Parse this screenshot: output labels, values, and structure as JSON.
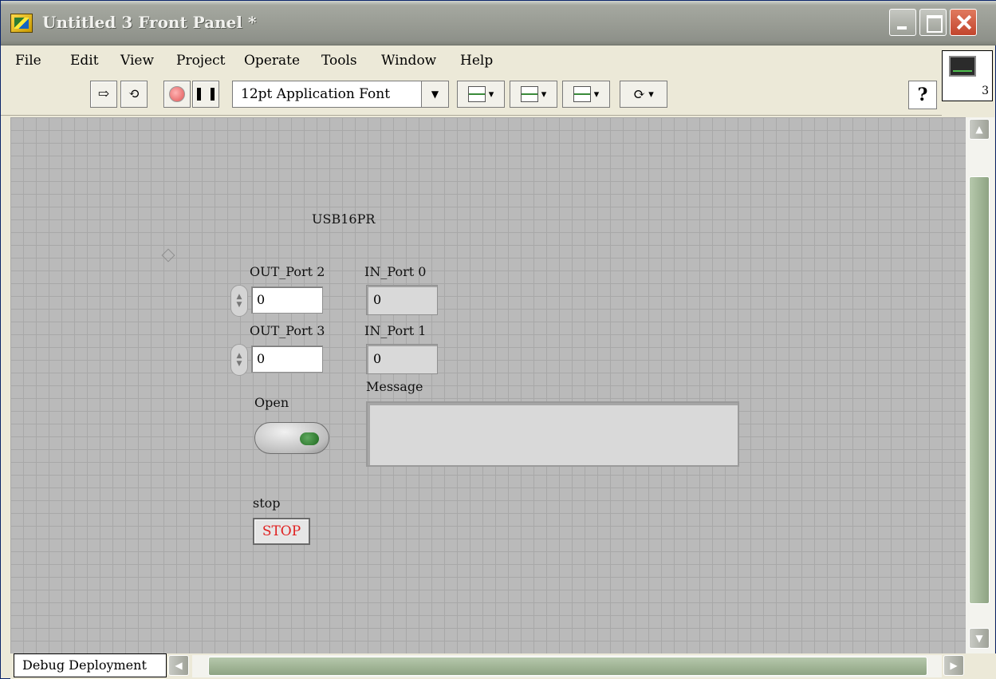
{
  "window": {
    "title": "Untitled 3 Front Panel *"
  },
  "menu": {
    "items": [
      "File",
      "Edit",
      "View",
      "Project",
      "Operate",
      "Tools",
      "Window",
      "Help"
    ]
  },
  "toolbar": {
    "font_select": "12pt Application Font",
    "help_glyph": "?"
  },
  "vi_icon": {
    "number": "3"
  },
  "panel": {
    "title": "USB16PR",
    "controls": {
      "out_port2_label": "OUT_Port 2",
      "out_port2_value": "0",
      "out_port3_label": "OUT_Port 3",
      "out_port3_value": "0",
      "in_port0_label": "IN_Port 0",
      "in_port0_value": "0",
      "in_port1_label": "IN_Port 1",
      "in_port1_value": "0",
      "message_label": "Message",
      "message_value": "",
      "open_label": "Open",
      "stop_label": "stop",
      "stop_button_text": "STOP"
    }
  },
  "status": {
    "context": "Debug Deployment"
  },
  "colors": {
    "panel_bg": "#bababa",
    "stop_text": "#e02020",
    "led_green": "#2e7d32",
    "titlebar": "#9a9d95"
  }
}
